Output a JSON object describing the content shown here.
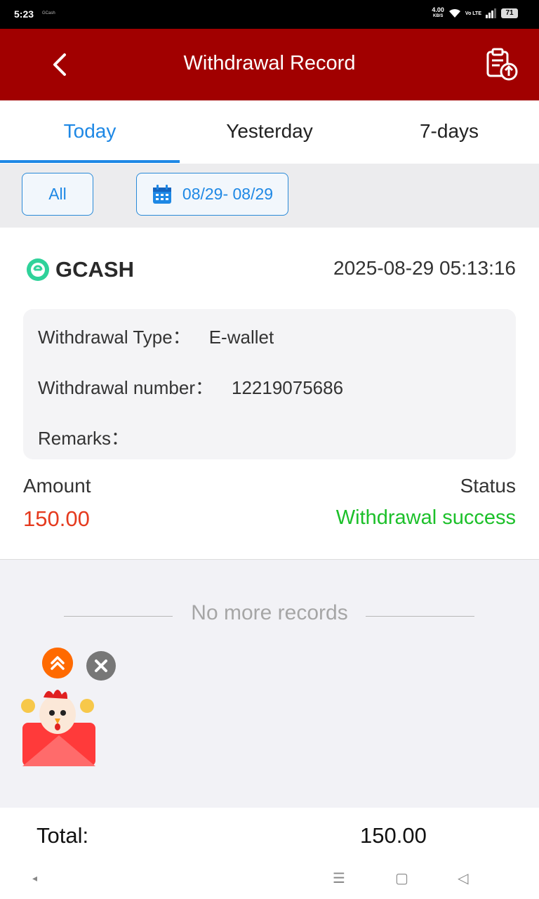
{
  "status_bar": {
    "time": "5:23",
    "notification_text": "GCash",
    "net_speed_value": "4.00",
    "net_speed_unit": "KB/S",
    "volte": "Vo LTE",
    "battery": "71"
  },
  "header": {
    "title": "Withdrawal Record",
    "back_icon": "chevron-left-icon",
    "action_icon": "clipboard-upload-icon"
  },
  "tabs": [
    {
      "label": "Today",
      "active": true
    },
    {
      "label": "Yesterday",
      "active": false
    },
    {
      "label": "7-days",
      "active": false
    }
  ],
  "filters": {
    "type_label": "All",
    "date_range": "08/29- 08/29",
    "date_icon": "calendar-icon"
  },
  "records": [
    {
      "channel": "GCASH",
      "channel_icon": "gcash-logo-icon",
      "datetime": "2025-08-29 05:13:16",
      "withdrawal_type_label": "Withdrawal Type：",
      "withdrawal_type_value": "E-wallet",
      "withdrawal_number_label": "Withdrawal number：",
      "withdrawal_number_value": "12219075686",
      "remarks_label": "Remarks：",
      "remarks_value": "",
      "amount_label": "Amount",
      "amount_value": "150.00",
      "status_label": "Status",
      "status_value": "Withdrawal success"
    }
  ],
  "list_end_text": "No more records",
  "floating": {
    "scroll_top_icon": "double-chevron-up-icon",
    "close_icon": "close-icon",
    "promo_icon": "rooster-red-envelope-icon"
  },
  "footer": {
    "total_label": "Total:",
    "total_value": "150.00"
  },
  "nav_bar": {
    "left": "◂",
    "menu": "☰",
    "home": "▢",
    "back": "◁"
  },
  "colors": {
    "header_bg": "#a10000",
    "accent_blue": "#1e88e5",
    "amount_red": "#e53a1e",
    "success_green": "#1cc02a"
  }
}
